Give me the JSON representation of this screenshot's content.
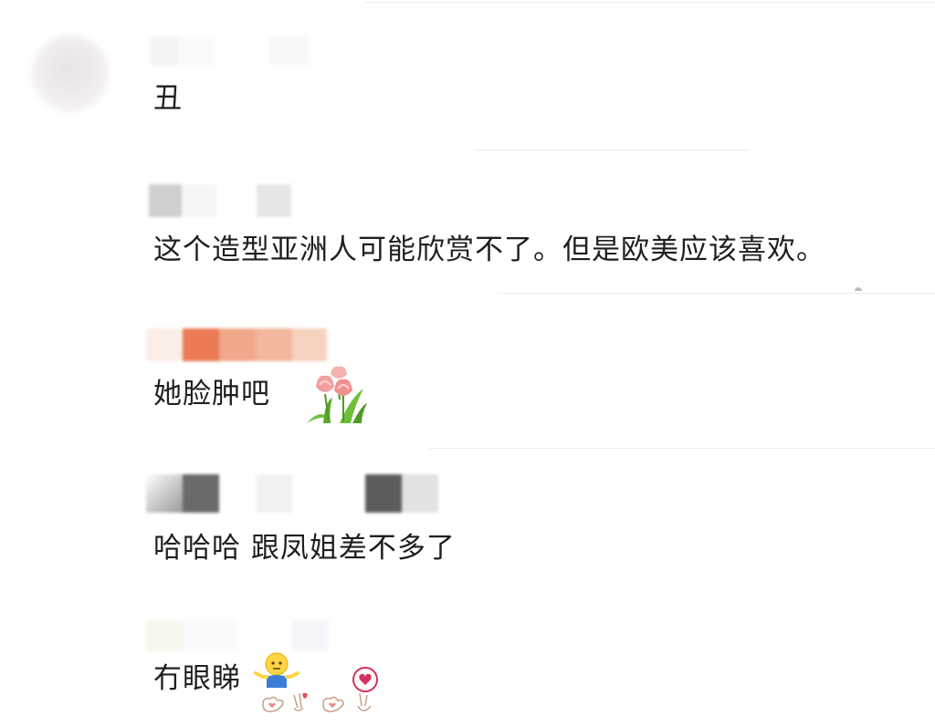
{
  "comments": [
    {
      "text": "丑"
    },
    {
      "text": "这个造型亚洲人可能欣赏不了。但是欧美应该喜欢。"
    },
    {
      "text": "她脸肿吧"
    },
    {
      "text": "哈哈哈 跟凤姐差不多了"
    },
    {
      "text": "冇眼睇"
    }
  ],
  "icons": {
    "tulip_sticker": "tulip-flowers-icon",
    "shrug_emoji": "shrug-emoji-icon",
    "hand_gestures": "hand-gestures-icon",
    "heart_badge": "heart-icon"
  },
  "colors": {
    "text": "#1f1f1f",
    "separator": "#ececec",
    "tulip_pink": "#f2a0a0",
    "leaf_green": "#6fbf3a",
    "heart_red": "#d2335c"
  }
}
